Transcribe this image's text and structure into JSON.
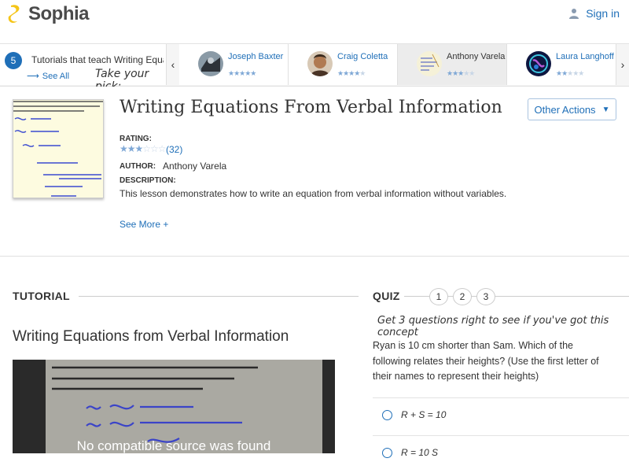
{
  "header": {
    "logo_text": "Sophia",
    "signin_label": "Sign in"
  },
  "tutorbar": {
    "count": "5",
    "teach_text": "Tutorials that teach Writing Equations From Verbal Information",
    "see_all": "See All",
    "pick_text": "Take your pick:",
    "teachers": [
      {
        "name": "Joseph Baxter",
        "stars": 5
      },
      {
        "name": "Craig Coletta",
        "stars": 4
      },
      {
        "name": "Anthony Varela",
        "stars": 3
      },
      {
        "name": "Laura Langhoff",
        "stars": 2
      }
    ]
  },
  "lesson": {
    "title": "Writing Equations From Verbal Information",
    "other_actions": "Other Actions",
    "rating_label": "RATING:",
    "rating_stars": 3,
    "rating_count": "(32)",
    "author_label": "AUTHOR:",
    "author": "Anthony Varela",
    "description_label": "DESCRIPTION:",
    "description": "This lesson demonstrates how to write an equation from verbal information without variables.",
    "see_more": "See More +"
  },
  "tutorial": {
    "heading": "TUTORIAL",
    "title": "Writing Equations from Verbal Information",
    "video_message": "No compatible source was found"
  },
  "quiz": {
    "heading": "QUIZ",
    "numbers": [
      "1",
      "2",
      "3"
    ],
    "tagline": "Get 3 questions right to see if you've got this concept",
    "question": "Ryan is 10 cm shorter than Sam. Which of the following relates their heights? (Use the first letter of their names to represent their heights)",
    "answers": [
      "R + S = 10",
      "R = 10 S"
    ]
  },
  "colors": {
    "accent": "#1f6fb8",
    "logo": "#f5c518"
  }
}
